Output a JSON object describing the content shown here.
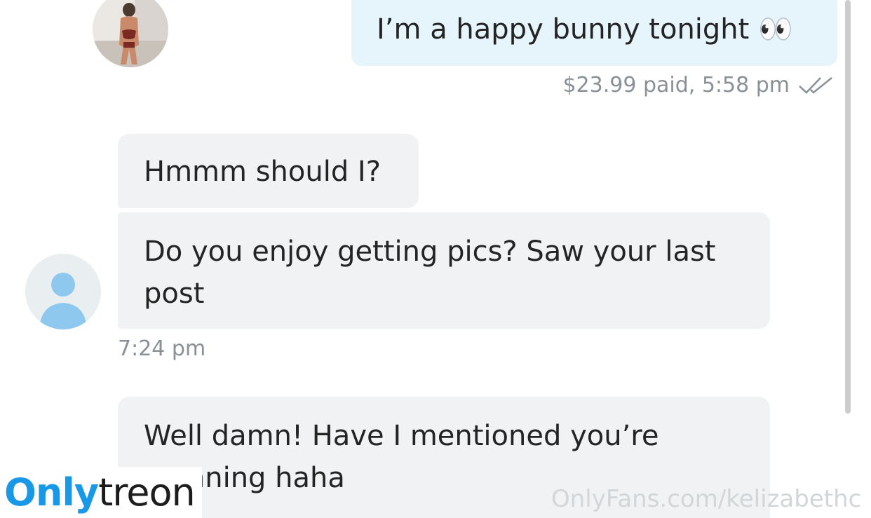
{
  "conversation": {
    "outgoing": {
      "text": "I’m a happy bunny tonight 👀",
      "meta": "$23.99 paid,  5:58 pm"
    },
    "incoming": [
      {
        "text": "Hmmm should I?"
      },
      {
        "text": "Do you enjoy getting pics? Saw your last post"
      },
      {
        "text": "Well damn! Have I mentioned you’re stunning haha"
      }
    ],
    "incoming_time": "7:24 pm"
  },
  "icons": {
    "read_receipt": "double-check-icon",
    "default_avatar": "user-placeholder-icon"
  },
  "watermark": {
    "site": "OnlyFans.com/kelizabethc",
    "logo_part1": "Only",
    "logo_part2": "treon"
  },
  "colors": {
    "outgoing_bubble": "#e6f4fb",
    "incoming_bubble": "#f0f2f3",
    "meta_text": "#8a9196",
    "check_color": "#8a9196",
    "logo_blue": "#1a98e8",
    "avatar_icon": "#8ec8ee"
  }
}
